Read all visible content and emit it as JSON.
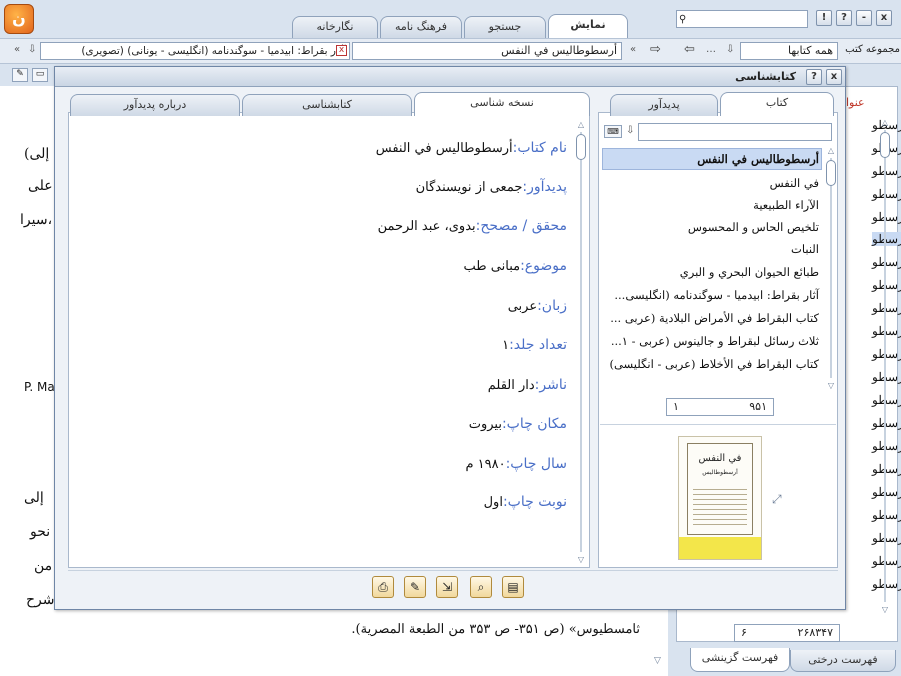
{
  "top_tabs": [
    "نمایش",
    "جستجو",
    "فرهنگ نامه",
    "نگارخانه"
  ],
  "search_placeholder": "",
  "title_buttons": [
    "!",
    "?",
    "-",
    "x"
  ],
  "toolbar": {
    "doc_tab_1": "أرسطوطاليس في النفس",
    "doc_tab_2": "آثار بقراط: ابيدميا - سوگندنامه (انگلیسی - یونانی) (تصویری)",
    "collection_label": "مجموعه کتب",
    "collection_value": "همه کتابها"
  },
  "dialog": {
    "title": "کتابشناسی",
    "left_tabs": [
      "نسخه شناسی",
      "کتابشناسی",
      "درباره پدیدآور"
    ],
    "right_tabs": [
      "کتاب",
      "پدیدآور"
    ],
    "search_value": "",
    "metadata": [
      {
        "label": "نام کتاب:",
        "value": "أرسطوطاليس في النفس"
      },
      {
        "label": "پدیدآور:",
        "value": "جمعی از نویسندگان"
      },
      {
        "label": "محقق / مصحح:",
        "value": "بدوی، عبد الرحمن"
      },
      {
        "label": "موضوع:",
        "value": "مبانی طب"
      },
      {
        "label": "زبان:",
        "value": "عربی"
      },
      {
        "label": "تعداد جلد:",
        "value": "۱"
      },
      {
        "label": "ناشر:",
        "value": "دار القلم"
      },
      {
        "label": "مکان چاپ:",
        "value": "بیروت"
      },
      {
        "label": "سال چاپ:",
        "value": "۱۹۸۰ م"
      },
      {
        "label": "نوبت چاپ:",
        "value": "اول"
      }
    ],
    "book_list": [
      "أرسطوطاليس في النفس",
      "في النفس",
      "الآراء الطبيعية",
      "تلخيص الحاس و المحسوس",
      "النبات",
      "طبائع الحيوان البحري و البري",
      "آثار بقراط: ابيدميا - سوگندنامه (انگليسى...",
      "كتاب البقراط في الأمراض البلادية (عربى ...",
      "ثلاث رسائل لبقراط و جالينوس (عربى - ١...",
      "كتاب البقراط في الأخلاط (عربى - انگليسى)"
    ],
    "pager_total": "۹۵۱",
    "pager_current": "۱",
    "cover": {
      "line1": "في النفس",
      "line2": "أرسطوطاليس"
    }
  },
  "background": {
    "lines_right": [
      "(إلى",
      "على",
      "سيرا،"
    ],
    "latin": "P. Ma",
    "lines_right_2": [
      "إلى",
      "نحو",
      "من",
      "شرح"
    ],
    "bottom_line": "ثامسطيوس» (ص ۳۵۱- ص ۳۵۳ من الطبعة المصرية)."
  },
  "right_panel": {
    "header": "عنوا",
    "items": [
      "أرسطو",
      "أرسطو",
      "أرسطو",
      "أرسطو",
      "أرسطو",
      "أرسطو",
      "أرسطو",
      "أرسطو",
      "أرسطو",
      "أرسطو",
      "أرسطو",
      "أرسطو",
      "أرسطو",
      "أرسطو",
      "أرسطو",
      "أرسطو",
      "أرسطو",
      "أرسطو",
      "أرسطو",
      "أرسطو",
      "أرسطو",
      "أرسطو"
    ],
    "pager_total": "۲۶۸۳۴۷",
    "pager_current": "۶",
    "bottom_tabs": [
      "فهرست درختی",
      "فهرست گزینشی"
    ]
  },
  "colors": {
    "accent": "#4a6fc7",
    "selected_row": "#c9daf3",
    "frame": "#7f93ad"
  }
}
